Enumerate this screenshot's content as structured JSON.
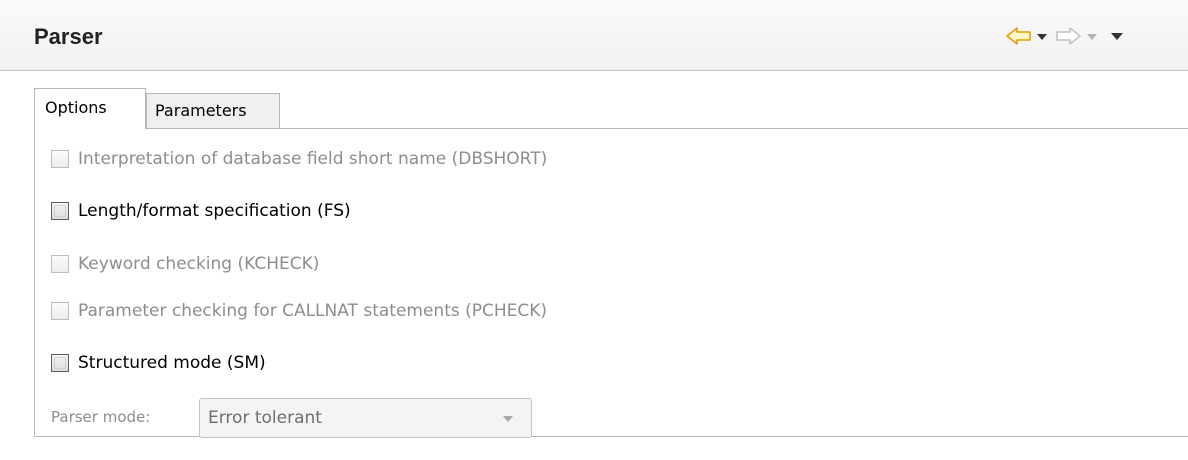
{
  "header": {
    "title": "Parser",
    "back_icon": "back-arrow-icon",
    "forward_icon": "forward-arrow-icon",
    "accent_color": "#e8a500"
  },
  "tabs": [
    {
      "label": "Options",
      "active": true
    },
    {
      "label": "Parameters",
      "active": false
    }
  ],
  "options": [
    {
      "label": "Interpretation of database field short name (DBSHORT)",
      "enabled": false,
      "checked": false
    },
    {
      "label": "Length/format specification (FS)",
      "enabled": true,
      "checked": false
    },
    {
      "label": "Keyword checking (KCHECK)",
      "enabled": false,
      "checked": false
    },
    {
      "label": "Parameter checking for CALLNAT statements (PCHECK)",
      "enabled": false,
      "checked": false
    },
    {
      "label": "Structured mode (SM)",
      "enabled": true,
      "checked": false
    }
  ],
  "parser_mode": {
    "label": "Parser mode:",
    "value": "Error tolerant",
    "enabled": false
  }
}
